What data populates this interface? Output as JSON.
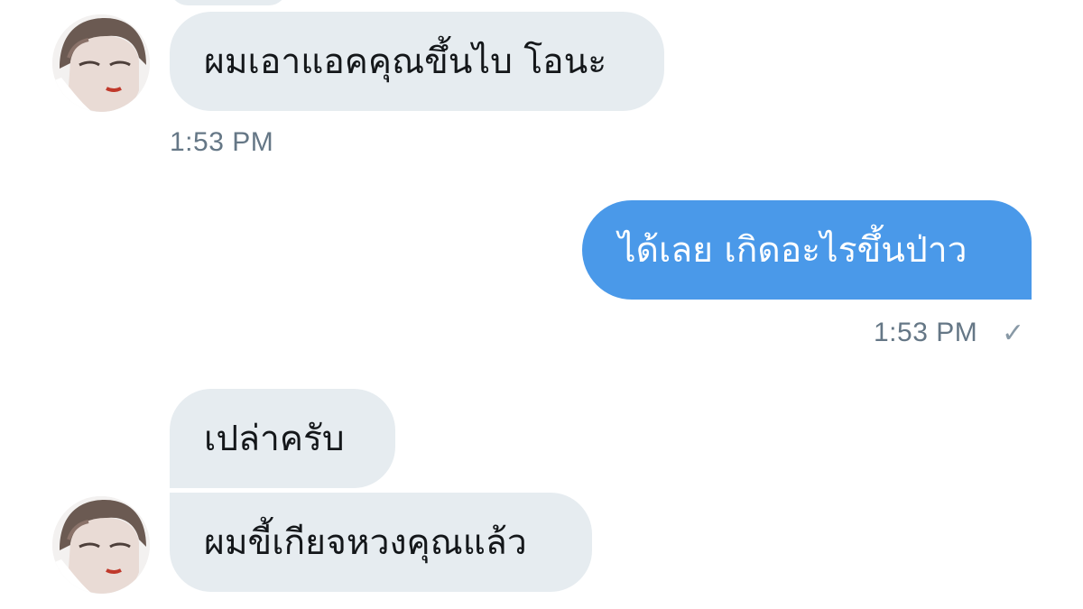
{
  "conversation": {
    "messages": [
      {
        "sender": "other",
        "text": "ผมเอาแอคคุณขึ้นไบ โอนะ"
      },
      {
        "sender": "me",
        "text": "ได้เลย เกิดอะไรขึ้นป่าว"
      },
      {
        "sender": "other",
        "text": "เปล่าครับ"
      },
      {
        "sender": "other",
        "text": "ผมขี้เกียจหวงคุณแล้ว"
      }
    ],
    "timestamps": {
      "first": "1:53 PM",
      "second": "1:53 PM"
    },
    "read_check_icon": "✓",
    "colors": {
      "incoming_bubble": "#e6ecf0",
      "outgoing_bubble": "#4a99e9",
      "timestamp": "#657786"
    }
  }
}
